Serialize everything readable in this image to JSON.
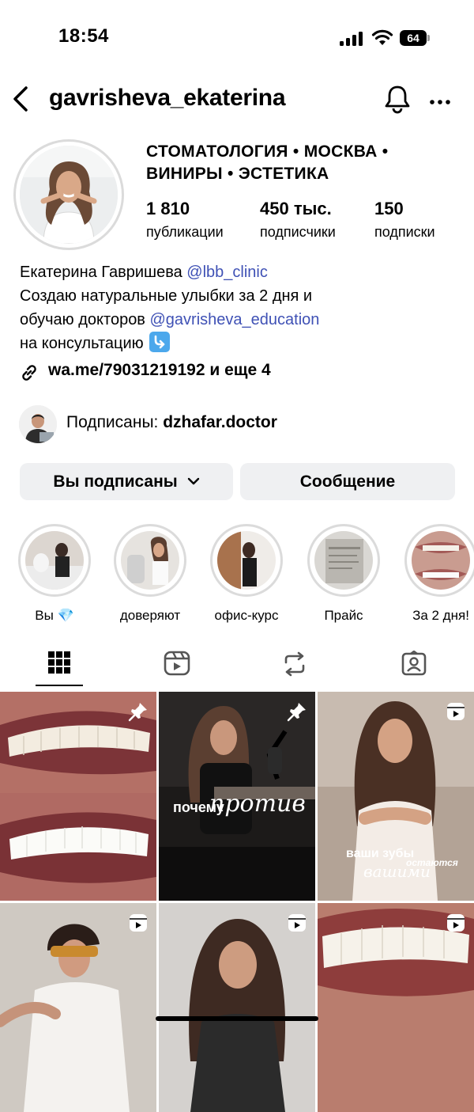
{
  "status_bar": {
    "time": "18:54",
    "battery": "64"
  },
  "header": {
    "username": "gavrisheva_ekaterina"
  },
  "profile": {
    "category_line1": "СТОМАТОЛОГИЯ • МОСКВА •",
    "category_line2": "ВИНИРЫ • ЭСТЕТИКА",
    "stats": [
      {
        "value": "1 810",
        "label": "публикации"
      },
      {
        "value": "450 тыс.",
        "label": "подписчики"
      },
      {
        "value": "150",
        "label": "подписки"
      }
    ],
    "bio": {
      "name": "Екатерина Гавришева",
      "name_mention": "@lbb_clinic",
      "line2": "Создаю натуральные улыбки за 2 дня и",
      "line3": "обучаю докторов",
      "line3_mention": "@gavrisheva_education",
      "line4": "на консультацию"
    },
    "link": "wa.me/79031219192 и еще 4",
    "followed_by_prefix": "Подписаны:",
    "followed_by_user": "dzhafar.doctor"
  },
  "buttons": {
    "following": "Вы подписаны",
    "message": "Сообщение"
  },
  "highlights": [
    {
      "label": "Вы 💎"
    },
    {
      "label": "доверяют"
    },
    {
      "label": "офис-курс"
    },
    {
      "label": "Прайс"
    },
    {
      "label": "За 2 дня!"
    }
  ],
  "tabs": [
    "grid-icon",
    "reels-icon",
    "repost-icon",
    "tagged-icon"
  ],
  "grid": {
    "post2_overlay_a": "почему",
    "post2_overlay_b": "против",
    "post3_overlay_a": "ваши зубы",
    "post3_overlay_b": "остаются",
    "post3_overlay_c": "вашими"
  },
  "colors": {
    "mention": "#3f51b5",
    "button_bg": "#eff0f2",
    "ring": "#dbdbdb"
  }
}
